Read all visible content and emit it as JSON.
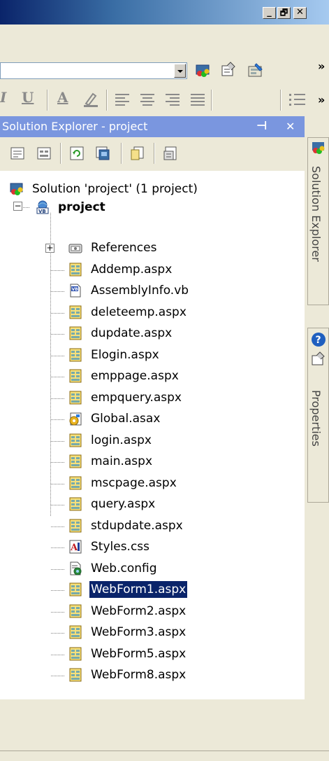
{
  "window": {
    "caption_buttons": [
      "_",
      "🗗",
      "✕"
    ]
  },
  "toolbar1": {
    "icons": [
      "solution-explorer-icon",
      "properties-icon",
      "toolbox-icon"
    ],
    "overflow": "»"
  },
  "toolbar2": {
    "format_buttons": [
      "I",
      "U",
      "A",
      "highlight"
    ],
    "overflow": "»"
  },
  "solution_explorer": {
    "title": "Solution Explorer - project",
    "pin": "⊣",
    "close": "✕",
    "solution": "Solution 'project' (1 project)",
    "project": "project",
    "expand_minus": "−",
    "expand_plus": "+",
    "items": [
      {
        "label": "References",
        "icon": "references-icon"
      },
      {
        "label": "Addemp.aspx",
        "icon": "webform-icon"
      },
      {
        "label": "AssemblyInfo.vb",
        "icon": "vb-file-icon"
      },
      {
        "label": "deleteemp.aspx",
        "icon": "webform-icon"
      },
      {
        "label": "dupdate.aspx",
        "icon": "webform-icon"
      },
      {
        "label": "Elogin.aspx",
        "icon": "webform-icon"
      },
      {
        "label": "emppage.aspx",
        "icon": "webform-icon"
      },
      {
        "label": "empquery.aspx",
        "icon": "webform-icon"
      },
      {
        "label": "Global.asax",
        "icon": "global-asax-icon"
      },
      {
        "label": "login.aspx",
        "icon": "webform-icon"
      },
      {
        "label": "main.aspx",
        "icon": "webform-icon"
      },
      {
        "label": "mscpage.aspx",
        "icon": "webform-icon"
      },
      {
        "label": "query.aspx",
        "icon": "webform-icon"
      },
      {
        "label": "stdupdate.aspx",
        "icon": "webform-icon"
      },
      {
        "label": "Styles.css",
        "icon": "css-icon"
      },
      {
        "label": "Web.config",
        "icon": "config-icon"
      },
      {
        "label": "WebForm1.aspx",
        "icon": "webform-icon",
        "selected": true
      },
      {
        "label": "WebForm2.aspx",
        "icon": "webform-icon"
      },
      {
        "label": "WebForm3.aspx",
        "icon": "webform-icon"
      },
      {
        "label": "WebForm5.aspx",
        "icon": "webform-icon"
      },
      {
        "label": "WebForm8.aspx",
        "icon": "webform-icon"
      }
    ]
  },
  "side_tabs": {
    "solution_explorer": "Solution Explorer",
    "properties": "Properties"
  },
  "colors": {
    "selection": "#0a246a",
    "panel_header": "#7a96df",
    "chrome": "#ece9d8"
  }
}
